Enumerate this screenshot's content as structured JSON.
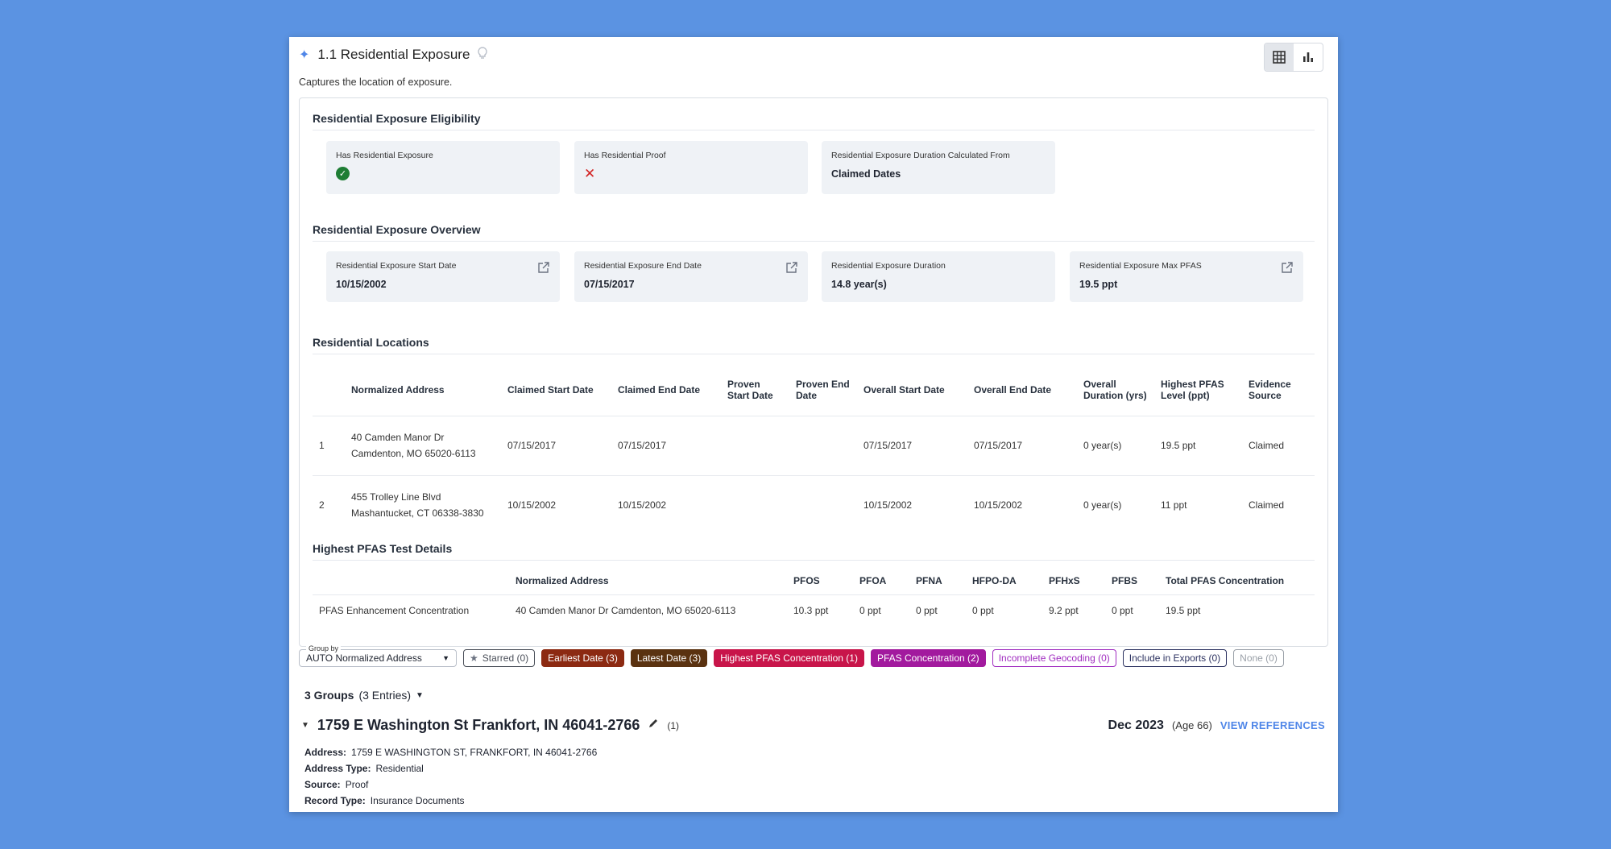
{
  "header": {
    "title": "1.1 Residential Exposure",
    "subtitle": "Captures the location of exposure."
  },
  "eligibility": {
    "heading": "Residential Exposure Eligibility",
    "has_residential_exposure_label": "Has Residential Exposure",
    "has_residential_proof_label": "Has Residential Proof",
    "duration_from_label": "Residential Exposure Duration Calculated From",
    "duration_from_value": "Claimed Dates"
  },
  "overview": {
    "heading": "Residential Exposure Overview",
    "tiles": [
      {
        "label": "Residential Exposure Start Date",
        "value": "10/15/2002"
      },
      {
        "label": "Residential Exposure End Date",
        "value": "07/15/2017"
      },
      {
        "label": "Residential Exposure Duration",
        "value": "14.8 year(s)"
      },
      {
        "label": "Residential Exposure Max PFAS",
        "value": "19.5 ppt"
      }
    ]
  },
  "locations": {
    "heading": "Residential Locations",
    "columns": [
      "",
      "Normalized Address",
      "Claimed Start Date",
      "Claimed End Date",
      "Proven Start Date",
      "Proven End Date",
      "Overall Start Date",
      "Overall End Date",
      "Overall Duration (yrs)",
      "Highest PFAS Level (ppt)",
      "Evidence Source"
    ],
    "rows": [
      [
        "1",
        "40 Camden Manor Dr Camdenton, MO 65020-6113",
        "07/15/2017",
        "07/15/2017",
        "",
        "",
        "07/15/2017",
        "07/15/2017",
        "0 year(s)",
        "19.5 ppt",
        "Claimed"
      ],
      [
        "2",
        "455 Trolley Line Blvd Mashantucket, CT 06338-3830",
        "10/15/2002",
        "10/15/2002",
        "",
        "",
        "10/15/2002",
        "10/15/2002",
        "0 year(s)",
        "11 ppt",
        "Claimed"
      ]
    ]
  },
  "pfas": {
    "heading": "Highest PFAS Test Details",
    "columns": [
      "",
      "Normalized Address",
      "PFOS",
      "PFOA",
      "PFNA",
      "HFPO-DA",
      "PFHxS",
      "PFBS",
      "Total PFAS Concentration"
    ],
    "rows": [
      [
        "PFAS Enhancement Concentration",
        "40 Camden Manor Dr Camdenton, MO 65020-6113",
        "10.3 ppt",
        "0 ppt",
        "0 ppt",
        "0 ppt",
        "9.2 ppt",
        "0 ppt",
        "19.5 ppt"
      ]
    ]
  },
  "filters": {
    "group_by_label": "Group by",
    "group_by_value": "AUTO Normalized Address",
    "chips": [
      {
        "label": "Starred (0)",
        "style": "outline",
        "color": "#4a4f59"
      },
      {
        "label": "Earliest Date (3)",
        "style": "solid",
        "color": "#8c2a12"
      },
      {
        "label": "Latest Date (3)",
        "style": "solid",
        "color": "#5a3210"
      },
      {
        "label": "Highest PFAS Concentration (1)",
        "style": "solid",
        "color": "#c8154a"
      },
      {
        "label": "PFAS Concentration (2)",
        "style": "solid",
        "color": "#a21a9e"
      },
      {
        "label": "Incomplete Geocoding (0)",
        "style": "outline",
        "color": "#a02cc0"
      },
      {
        "label": "Include in Exports (0)",
        "style": "outline",
        "color": "#2c3260"
      },
      {
        "label": "None (0)",
        "style": "outline",
        "color": "#9aa0a8"
      }
    ]
  },
  "groups": {
    "count_label": "3 Groups",
    "entries_label": "(3 Entries)"
  },
  "group": {
    "address": "1759 E Washington St Frankfort, IN 46041-2766",
    "count": "(1)",
    "date": "Dec 2023",
    "age": "(Age 66)",
    "view_refs": "VIEW REFERENCES",
    "details": [
      {
        "label": "Address:",
        "value": "1759 E WASHINGTON ST, FRANKFORT, IN 46041-2766"
      },
      {
        "label": "Address Type:",
        "value": "Residential"
      },
      {
        "label": "Source:",
        "value": "Proof"
      },
      {
        "label": "Record Type:",
        "value": "Insurance Documents"
      }
    ]
  }
}
